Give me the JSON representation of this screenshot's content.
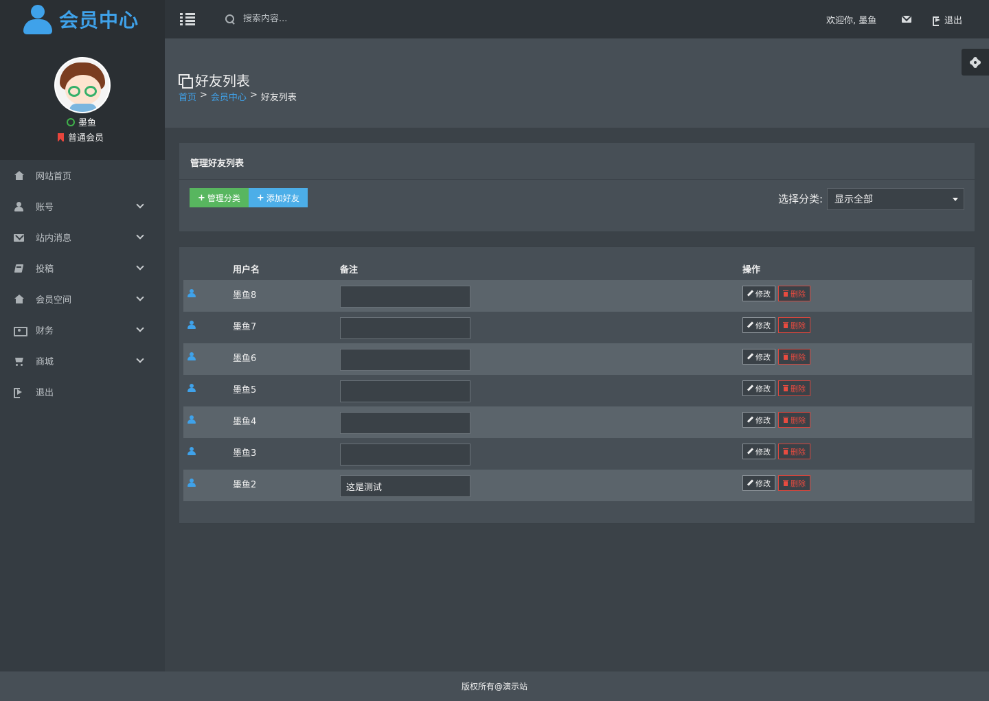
{
  "app": {
    "logo_text": "会员中心"
  },
  "topbar": {
    "search_placeholder": "搜索内容...",
    "welcome": "欢迎你, 墨鱼",
    "logout": "退出"
  },
  "profile": {
    "name": "墨鱼",
    "level": "普通会员"
  },
  "sidebar": {
    "items": [
      {
        "label": "网站首页",
        "icon": "home-icon",
        "expandable": false
      },
      {
        "label": "账号",
        "icon": "user-icon",
        "expandable": true
      },
      {
        "label": "站内消息",
        "icon": "envelope-icon",
        "expandable": true
      },
      {
        "label": "投稿",
        "icon": "book-icon",
        "expandable": true
      },
      {
        "label": "会员空间",
        "icon": "home-icon",
        "expandable": true
      },
      {
        "label": "财务",
        "icon": "money-icon",
        "expandable": true
      },
      {
        "label": "商城",
        "icon": "cart-icon",
        "expandable": true
      },
      {
        "label": "退出",
        "icon": "signout-icon",
        "expandable": false
      }
    ]
  },
  "page": {
    "title": "好友列表",
    "breadcrumb": {
      "home": "首页",
      "sep": ">",
      "section": "会员中心",
      "current": "好友列表"
    }
  },
  "manage_panel": {
    "title": "管理好友列表",
    "btn_manage_category": "管理分类",
    "btn_add_friend": "添加好友",
    "filter_label": "选择分类:",
    "filter_selected": "显示全部"
  },
  "friends_table": {
    "headers": {
      "username": "用户名",
      "note": "备注",
      "actions": "操作"
    },
    "edit_label": "修改",
    "delete_label": "删除",
    "rows": [
      {
        "username": "墨鱼8",
        "note": ""
      },
      {
        "username": "墨鱼7",
        "note": ""
      },
      {
        "username": "墨鱼6",
        "note": ""
      },
      {
        "username": "墨鱼5",
        "note": ""
      },
      {
        "username": "墨鱼4",
        "note": ""
      },
      {
        "username": "墨鱼3",
        "note": ""
      },
      {
        "username": "墨鱼2",
        "note": "这是测试"
      }
    ]
  },
  "footer": {
    "text": "版权所有@演示站"
  },
  "colors": {
    "accent": "#3fa2ea",
    "success": "#58b65f",
    "info": "#4caee8",
    "danger": "#e84b40"
  }
}
